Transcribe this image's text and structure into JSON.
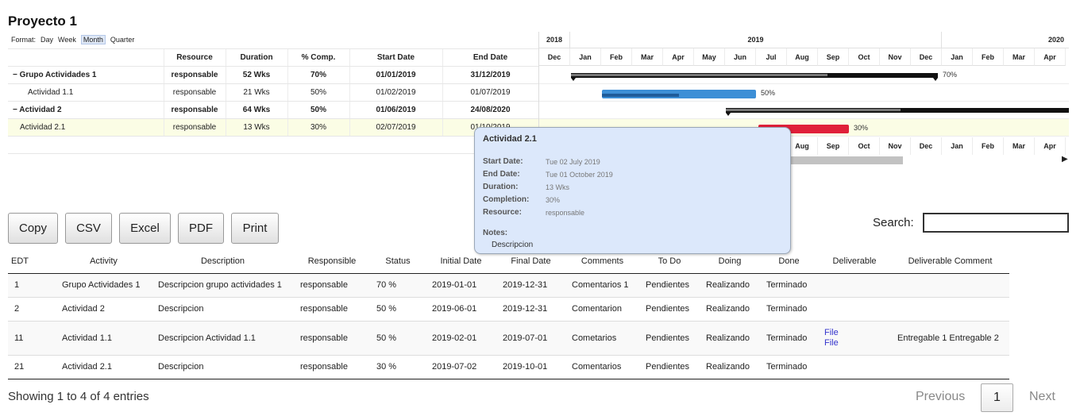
{
  "page": {
    "title": "Proyecto 1"
  },
  "gantt": {
    "format_label": "Format:",
    "formats": [
      "Day",
      "Week",
      "Month",
      "Quarter"
    ],
    "active_format": "Month",
    "columns": [
      "Resource",
      "Duration",
      "% Comp.",
      "Start Date",
      "End Date"
    ],
    "rows": [
      {
        "name": "− Grupo Actividades 1",
        "resource": "responsable",
        "duration": "52 Wks",
        "comp": "70%",
        "start": "01/01/2019",
        "end": "31/12/2019",
        "bold": true,
        "indent": 0
      },
      {
        "name": "Actividad 1.1",
        "resource": "responsable",
        "duration": "21 Wks",
        "comp": "50%",
        "start": "01/02/2019",
        "end": "01/07/2019",
        "bold": false,
        "indent": 2
      },
      {
        "name": "− Actividad 2",
        "resource": "responsable",
        "duration": "64 Wks",
        "comp": "50%",
        "start": "01/06/2019",
        "end": "24/08/2020",
        "bold": true,
        "indent": 0
      },
      {
        "name": "Actividad 2.1",
        "resource": "responsable",
        "duration": "13 Wks",
        "comp": "30%",
        "start": "02/07/2019",
        "end": "01/10/2019",
        "bold": false,
        "indent": 1,
        "selected": true
      }
    ],
    "years": [
      "2018",
      "2019",
      "2020"
    ],
    "months": [
      "Dec",
      "Jan",
      "Feb",
      "Mar",
      "Apr",
      "May",
      "Jun",
      "Jul",
      "Aug",
      "Sep",
      "Oct",
      "Nov",
      "Dec",
      "Jan",
      "Feb",
      "Mar",
      "Apr"
    ],
    "bars": [
      {
        "pct": "70%",
        "progress": 0.7,
        "type": "summary"
      },
      {
        "pct": "50%",
        "progress": 0.5,
        "type": "task",
        "color": "#3d8fd6",
        "progcolor": "#1f5c9a"
      },
      {
        "pct": "",
        "progress": 0.5,
        "type": "summary"
      },
      {
        "pct": "30%",
        "progress": 0.3,
        "type": "task",
        "color": "#e0203a",
        "progcolor": "#9e0c20"
      }
    ]
  },
  "tooltip": {
    "title": "Actividad 2.1",
    "start_label": "Start Date:",
    "start": "Tue 02 July 2019",
    "end_label": "End Date:",
    "end": "Tue 01 October 2019",
    "duration_label": "Duration:",
    "duration": "13 Wks",
    "completion_label": "Completion:",
    "completion": "30%",
    "resource_label": "Resource:",
    "resource": "responsable",
    "notes_label": "Notes:",
    "notes": "Descripcion"
  },
  "buttons": {
    "copy": "Copy",
    "csv": "CSV",
    "excel": "Excel",
    "pdf": "PDF",
    "print": "Print"
  },
  "search": {
    "label": "Search:",
    "value": ""
  },
  "table": {
    "headers": [
      "EDT",
      "Activity",
      "Description",
      "Responsible",
      "Status",
      "Initial Date",
      "Final Date",
      "Comments",
      "To Do",
      "Doing",
      "Done",
      "Deliverable",
      "Deliverable Comment"
    ],
    "rows": [
      {
        "edt": "1",
        "activity": "Grupo Actividades 1",
        "description": "Descripcion grupo actividades 1",
        "responsible": "responsable",
        "status": "70 %",
        "initial": "2019-01-01",
        "final": "2019-12-31",
        "comments": "Comentarios 1",
        "todo": "Pendientes",
        "doing": "Realizando",
        "done": "Terminado",
        "deliverables": [],
        "deliv_comment": ""
      },
      {
        "edt": "2",
        "activity": "Actividad 2",
        "description": "Descripcion",
        "responsible": "responsable",
        "status": "50 %",
        "initial": "2019-06-01",
        "final": "2019-12-31",
        "comments": "Comentarion",
        "todo": "Pendientes",
        "doing": "Realizando",
        "done": "Terminado",
        "deliverables": [],
        "deliv_comment": ""
      },
      {
        "edt": "11",
        "activity": "Actividad 1.1",
        "description": "Descripcion Actividad 1.1",
        "responsible": "responsable",
        "status": "50 %",
        "initial": "2019-02-01",
        "final": "2019-07-01",
        "comments": "Cometarios",
        "todo": "Pendientes",
        "doing": "Realizando",
        "done": "Terminado",
        "deliverables": [
          "File",
          "File"
        ],
        "deliv_comment": "Entregable 1 Entregable 2"
      },
      {
        "edt": "21",
        "activity": "Actividad 2.1",
        "description": "Descripcion",
        "responsible": "responsable",
        "status": "30 %",
        "initial": "2019-07-02",
        "final": "2019-10-01",
        "comments": "Comentarios",
        "todo": "Pendientes",
        "doing": "Realizando",
        "done": "Terminado",
        "deliverables": [],
        "deliv_comment": ""
      }
    ]
  },
  "footer": {
    "info": "Showing 1 to 4 of 4 entries",
    "previous": "Previous",
    "page": "1",
    "next": "Next"
  }
}
